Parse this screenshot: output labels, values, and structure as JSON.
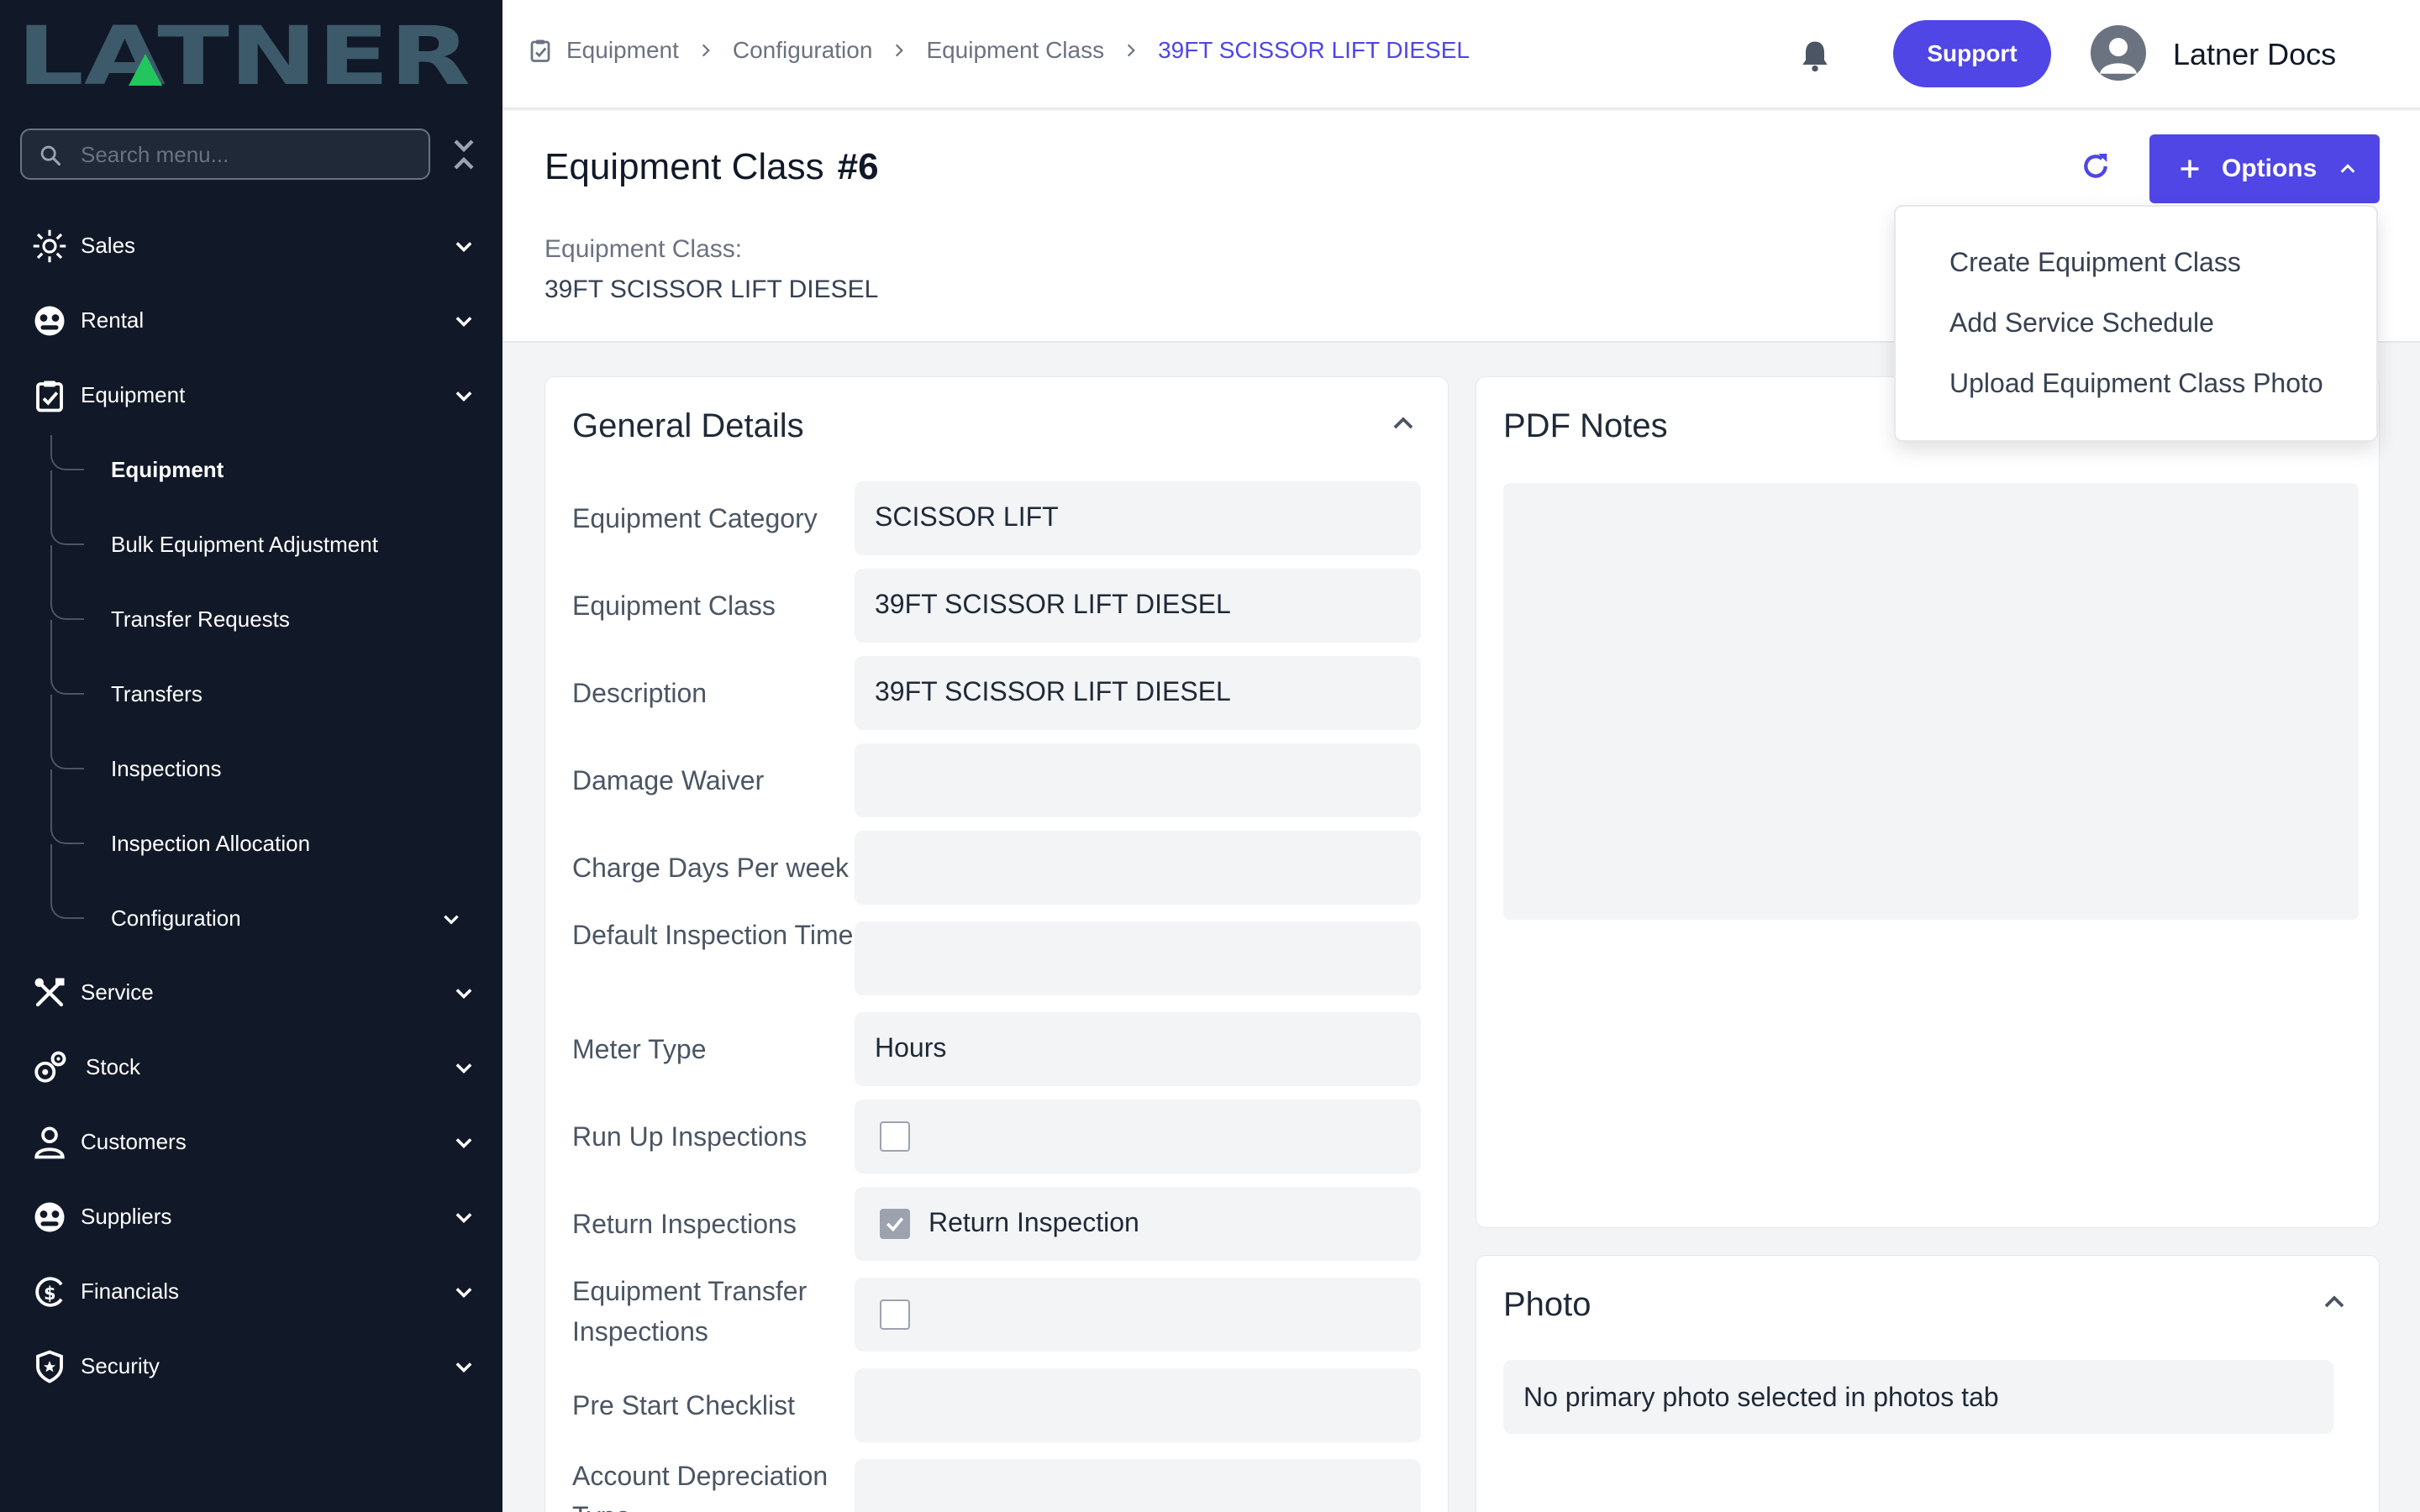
{
  "app": {
    "logo_text": "LATNER"
  },
  "sidebar": {
    "search_placeholder": "Search menu...",
    "items": [
      {
        "label": "Sales",
        "icon": "sales-icon"
      },
      {
        "label": "Rental",
        "icon": "rental-icon"
      },
      {
        "label": "Equipment",
        "icon": "equipment-icon"
      },
      {
        "label": "Service",
        "icon": "tools-icon"
      },
      {
        "label": "Stock",
        "icon": "stock-icon"
      },
      {
        "label": "Customers",
        "icon": "person-icon"
      },
      {
        "label": "Suppliers",
        "icon": "suppliers-icon"
      },
      {
        "label": "Financials",
        "icon": "dollar-icon"
      },
      {
        "label": "Security",
        "icon": "shield-icon"
      }
    ],
    "equipment_sub": [
      {
        "label": "Equipment"
      },
      {
        "label": "Bulk Equipment Adjustment"
      },
      {
        "label": "Transfer Requests"
      },
      {
        "label": "Transfers"
      },
      {
        "label": "Inspections"
      },
      {
        "label": "Inspection Allocation"
      },
      {
        "label": "Configuration"
      }
    ]
  },
  "topbar": {
    "breadcrumbs": [
      "Equipment",
      "Configuration",
      "Equipment Class",
      "39FT SCISSOR LIFT DIESEL"
    ],
    "support_label": "Support",
    "user_name": "Latner Docs"
  },
  "header": {
    "title": "Equipment Class",
    "number": "#6",
    "class_label": "Equipment Class:",
    "class_value": "39FT SCISSOR LIFT DIESEL",
    "options_label": "Options"
  },
  "options_menu": [
    "Create Equipment Class",
    "Add Service Schedule",
    "Upload Equipment Class Photo"
  ],
  "general_details": {
    "title": "General Details",
    "fields": [
      {
        "label": "Equipment Category",
        "value": "SCISSOR LIFT"
      },
      {
        "label": "Equipment Class",
        "value": "39FT SCISSOR LIFT DIESEL"
      },
      {
        "label": "Description",
        "value": "39FT SCISSOR LIFT DIESEL"
      },
      {
        "label": "Damage Waiver",
        "value": ""
      },
      {
        "label": "Charge Days Per week",
        "value": ""
      },
      {
        "label": "Default Inspection Time",
        "value": ""
      },
      {
        "label": "Meter Type",
        "value": "Hours"
      },
      {
        "label": "Run Up Inspections",
        "checked": false,
        "check_label": ""
      },
      {
        "label": "Return Inspections",
        "checked": true,
        "check_label": "Return Inspection"
      },
      {
        "label": "Equipment Transfer Inspections",
        "checked": false,
        "check_label": ""
      },
      {
        "label": "Pre Start Checklist",
        "value": ""
      },
      {
        "label": "Account Depreciation Type",
        "value": ""
      }
    ]
  },
  "pdf_notes": {
    "title": "PDF Notes"
  },
  "photo": {
    "title": "Photo",
    "message": "No primary photo selected in photos tab"
  },
  "colors": {
    "primary": "#4f46e5",
    "sidebar_bg": "#111827",
    "logo": "#3d5a6b",
    "logo_accent": "#22c55e"
  }
}
